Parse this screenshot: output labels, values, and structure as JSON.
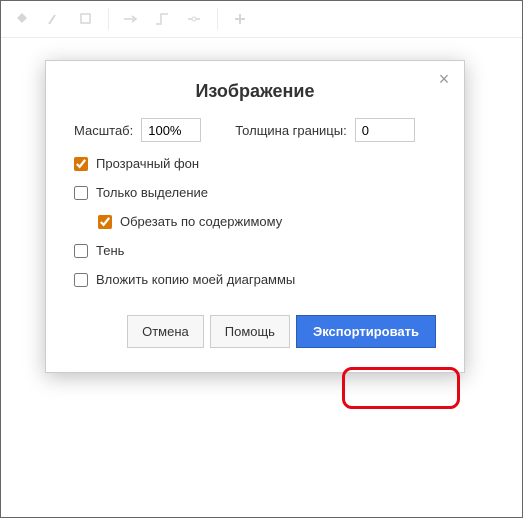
{
  "toolbar": {
    "icons": [
      "fill",
      "line",
      "shadow",
      "arrow",
      "connect",
      "waypoint",
      "plus"
    ]
  },
  "dialog": {
    "title": "Изображение",
    "zoom_label": "Масштаб:",
    "zoom_value": "100%",
    "border_label": "Толщина границы:",
    "border_value": "0",
    "checkbox_transparent": "Прозрачный фон",
    "checkbox_selection": "Только выделение",
    "checkbox_crop": "Обрезать по содержимому",
    "checkbox_shadow": "Тень",
    "checkbox_embed": "Вложить копию моей диаграммы",
    "checked": {
      "transparent": true,
      "selection": false,
      "crop": true,
      "shadow": false,
      "embed": false
    },
    "buttons": {
      "cancel": "Отмена",
      "help": "Помощь",
      "export": "Экспортировать"
    }
  }
}
